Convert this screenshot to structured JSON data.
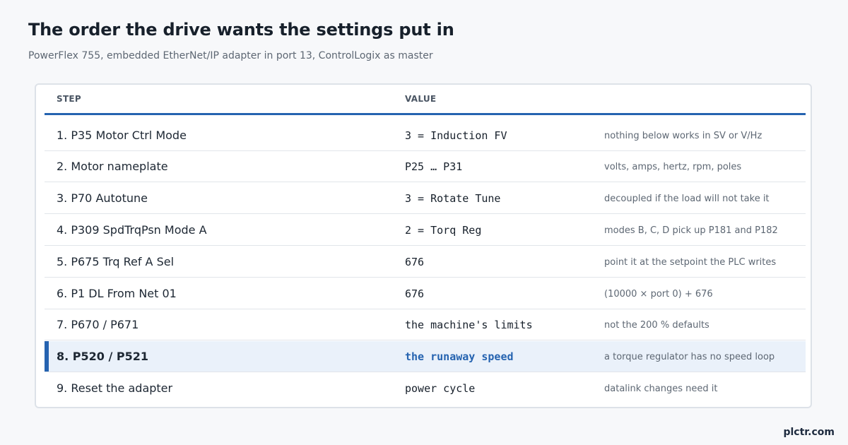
{
  "title": "The order the drive wants the settings put in",
  "subtitle": "PowerFlex 755, embedded EtherNet/IP adapter in port 13, ControlLogix as master",
  "table": {
    "headers": {
      "step": "STEP",
      "value": "VALUE"
    },
    "rows": [
      {
        "step": "1.  P35 Motor Ctrl Mode",
        "value": "3 = Induction FV",
        "note": "nothing below works in SV or V/Hz"
      },
      {
        "step": "2.  Motor nameplate",
        "value": "P25 … P31",
        "note": "volts, amps, hertz, rpm, poles"
      },
      {
        "step": "3.  P70 Autotune",
        "value": "3 = Rotate Tune",
        "note": "decoupled if the load will not take it"
      },
      {
        "step": "4.  P309 SpdTrqPsn Mode A",
        "value": "2 = Torq Reg",
        "note": "modes B, C, D pick up P181 and P182"
      },
      {
        "step": "5.  P675 Trq Ref A Sel",
        "value": "676",
        "note": "point it at the setpoint the PLC writes"
      },
      {
        "step": "6.  P1 DL From Net 01",
        "value": "676",
        "note": "(10000 × port 0) + 676"
      },
      {
        "step": "7.  P670 / P671",
        "value": "the machine's limits",
        "note": "not the 200 % defaults"
      },
      {
        "step": "8.  P520 / P521",
        "value": "the runaway speed",
        "note": "a torque regulator has no speed loop",
        "highlighted": true
      },
      {
        "step": "9.  Reset the adapter",
        "value": "power cycle",
        "note": "datalink changes need it"
      }
    ]
  },
  "brand": "plctr.com",
  "colors": {
    "accent": "#2563b0",
    "highlight_bg": "#eaf1fa"
  }
}
